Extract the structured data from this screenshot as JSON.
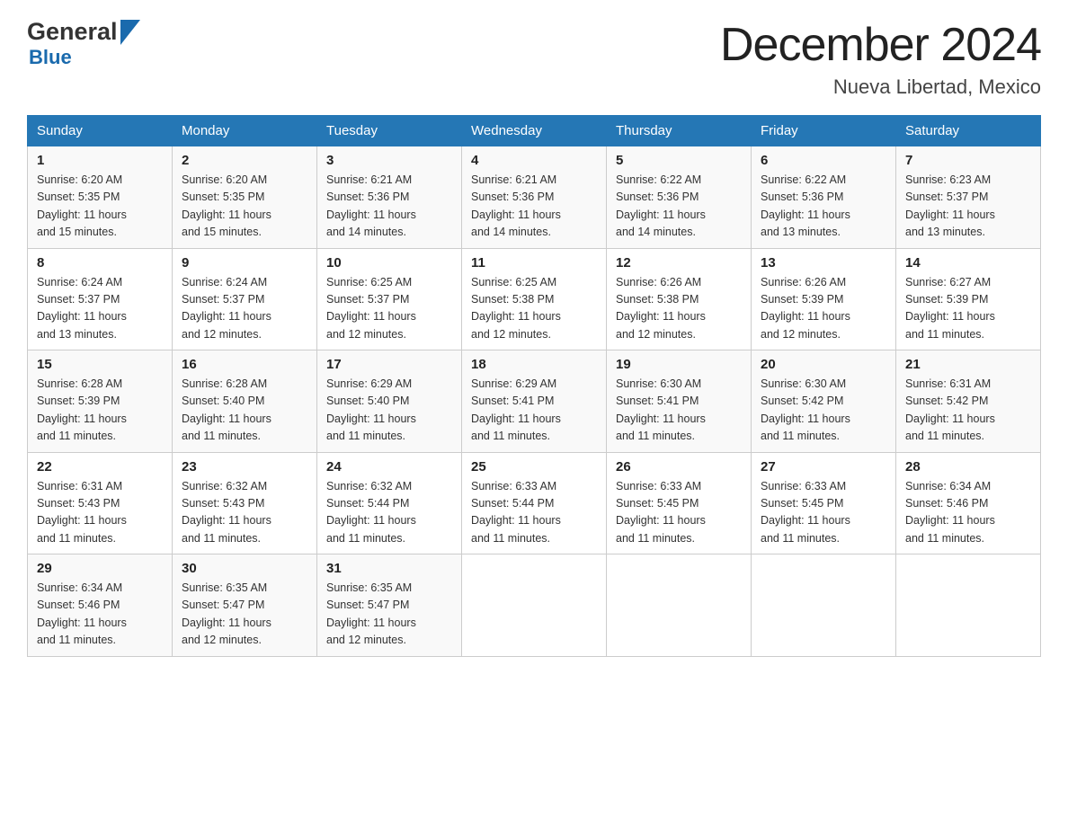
{
  "header": {
    "title": "December 2024",
    "subtitle": "Nueva Libertad, Mexico",
    "logo_general": "General",
    "logo_blue": "Blue"
  },
  "weekdays": [
    "Sunday",
    "Monday",
    "Tuesday",
    "Wednesday",
    "Thursday",
    "Friday",
    "Saturday"
  ],
  "weeks": [
    [
      {
        "day": "1",
        "sunrise": "6:20 AM",
        "sunset": "5:35 PM",
        "daylight": "11 hours and 15 minutes."
      },
      {
        "day": "2",
        "sunrise": "6:20 AM",
        "sunset": "5:35 PM",
        "daylight": "11 hours and 15 minutes."
      },
      {
        "day": "3",
        "sunrise": "6:21 AM",
        "sunset": "5:36 PM",
        "daylight": "11 hours and 14 minutes."
      },
      {
        "day": "4",
        "sunrise": "6:21 AM",
        "sunset": "5:36 PM",
        "daylight": "11 hours and 14 minutes."
      },
      {
        "day": "5",
        "sunrise": "6:22 AM",
        "sunset": "5:36 PM",
        "daylight": "11 hours and 14 minutes."
      },
      {
        "day": "6",
        "sunrise": "6:22 AM",
        "sunset": "5:36 PM",
        "daylight": "11 hours and 13 minutes."
      },
      {
        "day": "7",
        "sunrise": "6:23 AM",
        "sunset": "5:37 PM",
        "daylight": "11 hours and 13 minutes."
      }
    ],
    [
      {
        "day": "8",
        "sunrise": "6:24 AM",
        "sunset": "5:37 PM",
        "daylight": "11 hours and 13 minutes."
      },
      {
        "day": "9",
        "sunrise": "6:24 AM",
        "sunset": "5:37 PM",
        "daylight": "11 hours and 12 minutes."
      },
      {
        "day": "10",
        "sunrise": "6:25 AM",
        "sunset": "5:37 PM",
        "daylight": "11 hours and 12 minutes."
      },
      {
        "day": "11",
        "sunrise": "6:25 AM",
        "sunset": "5:38 PM",
        "daylight": "11 hours and 12 minutes."
      },
      {
        "day": "12",
        "sunrise": "6:26 AM",
        "sunset": "5:38 PM",
        "daylight": "11 hours and 12 minutes."
      },
      {
        "day": "13",
        "sunrise": "6:26 AM",
        "sunset": "5:39 PM",
        "daylight": "11 hours and 12 minutes."
      },
      {
        "day": "14",
        "sunrise": "6:27 AM",
        "sunset": "5:39 PM",
        "daylight": "11 hours and 11 minutes."
      }
    ],
    [
      {
        "day": "15",
        "sunrise": "6:28 AM",
        "sunset": "5:39 PM",
        "daylight": "11 hours and 11 minutes."
      },
      {
        "day": "16",
        "sunrise": "6:28 AM",
        "sunset": "5:40 PM",
        "daylight": "11 hours and 11 minutes."
      },
      {
        "day": "17",
        "sunrise": "6:29 AM",
        "sunset": "5:40 PM",
        "daylight": "11 hours and 11 minutes."
      },
      {
        "day": "18",
        "sunrise": "6:29 AM",
        "sunset": "5:41 PM",
        "daylight": "11 hours and 11 minutes."
      },
      {
        "day": "19",
        "sunrise": "6:30 AM",
        "sunset": "5:41 PM",
        "daylight": "11 hours and 11 minutes."
      },
      {
        "day": "20",
        "sunrise": "6:30 AM",
        "sunset": "5:42 PM",
        "daylight": "11 hours and 11 minutes."
      },
      {
        "day": "21",
        "sunrise": "6:31 AM",
        "sunset": "5:42 PM",
        "daylight": "11 hours and 11 minutes."
      }
    ],
    [
      {
        "day": "22",
        "sunrise": "6:31 AM",
        "sunset": "5:43 PM",
        "daylight": "11 hours and 11 minutes."
      },
      {
        "day": "23",
        "sunrise": "6:32 AM",
        "sunset": "5:43 PM",
        "daylight": "11 hours and 11 minutes."
      },
      {
        "day": "24",
        "sunrise": "6:32 AM",
        "sunset": "5:44 PM",
        "daylight": "11 hours and 11 minutes."
      },
      {
        "day": "25",
        "sunrise": "6:33 AM",
        "sunset": "5:44 PM",
        "daylight": "11 hours and 11 minutes."
      },
      {
        "day": "26",
        "sunrise": "6:33 AM",
        "sunset": "5:45 PM",
        "daylight": "11 hours and 11 minutes."
      },
      {
        "day": "27",
        "sunrise": "6:33 AM",
        "sunset": "5:45 PM",
        "daylight": "11 hours and 11 minutes."
      },
      {
        "day": "28",
        "sunrise": "6:34 AM",
        "sunset": "5:46 PM",
        "daylight": "11 hours and 11 minutes."
      }
    ],
    [
      {
        "day": "29",
        "sunrise": "6:34 AM",
        "sunset": "5:46 PM",
        "daylight": "11 hours and 11 minutes."
      },
      {
        "day": "30",
        "sunrise": "6:35 AM",
        "sunset": "5:47 PM",
        "daylight": "11 hours and 12 minutes."
      },
      {
        "day": "31",
        "sunrise": "6:35 AM",
        "sunset": "5:47 PM",
        "daylight": "11 hours and 12 minutes."
      },
      null,
      null,
      null,
      null
    ]
  ],
  "labels": {
    "sunrise": "Sunrise:",
    "sunset": "Sunset:",
    "daylight": "Daylight:"
  }
}
